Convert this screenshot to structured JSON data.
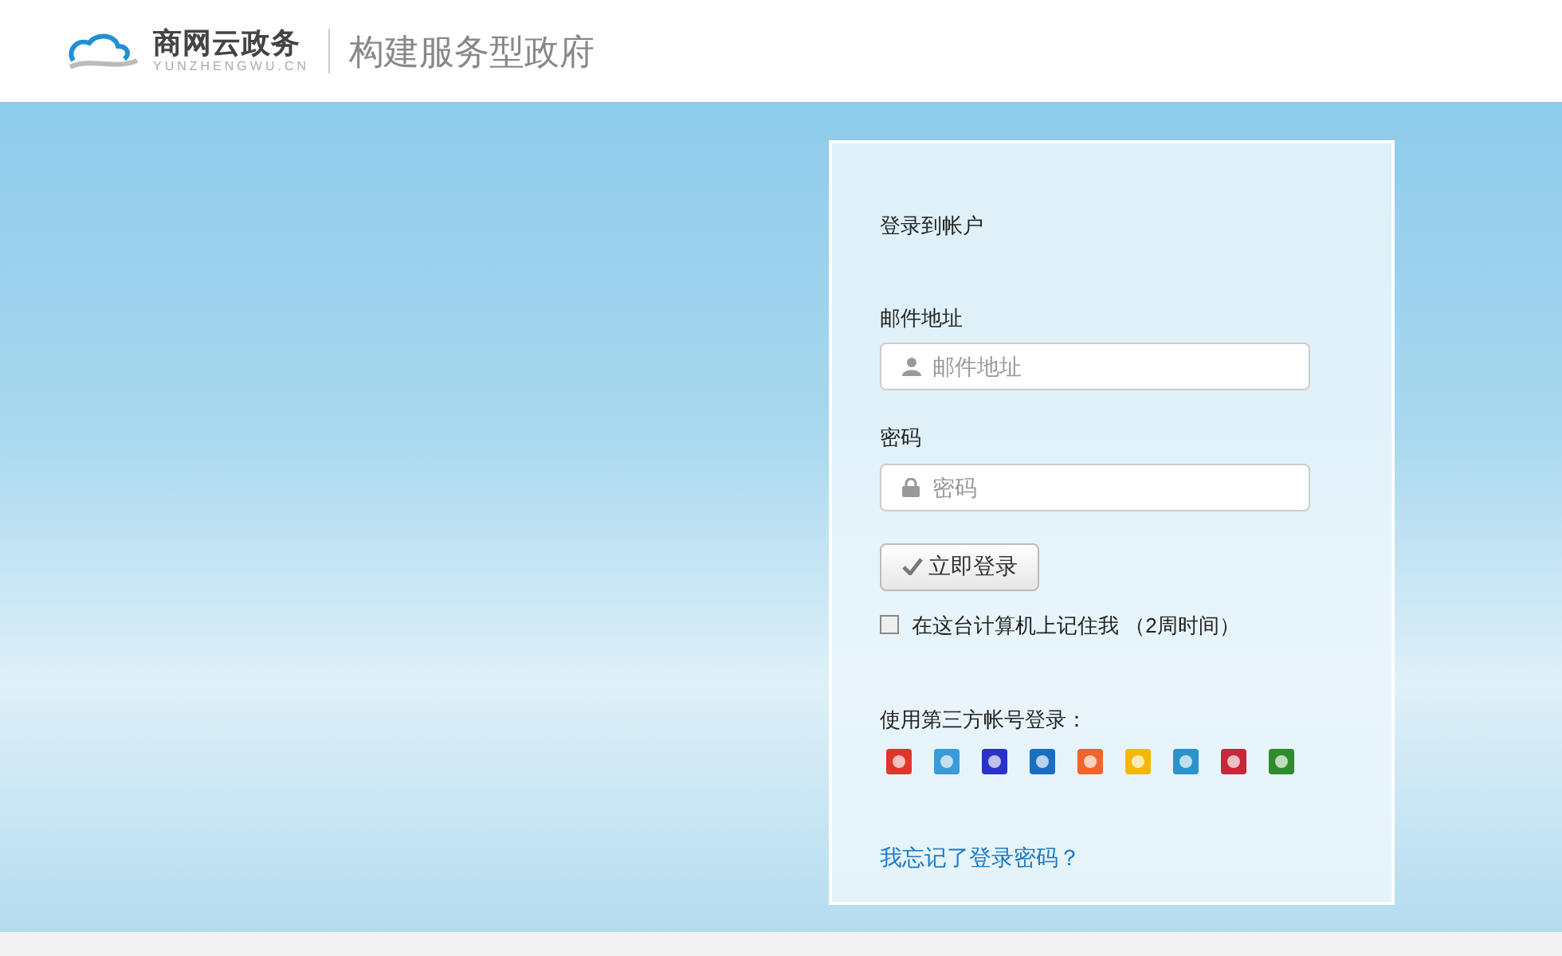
{
  "header": {
    "brand": "商网云政务",
    "domain": "YUNZHENGWU.CN",
    "slogan": "构建服务型政府"
  },
  "login": {
    "title": "登录到帐户",
    "fields": [
      {
        "kind": "email",
        "label": "邮件地址",
        "placeholder": "邮件地址"
      },
      {
        "kind": "password",
        "label": "密码",
        "placeholder": "密码"
      }
    ],
    "submit": "立即登录",
    "remember": {
      "label": "在这台计算机上记住我 （2周时间）",
      "checked": false
    },
    "third_party_label": "使用第三方帐号登录：",
    "providers": [
      {
        "color": "#e0352b"
      },
      {
        "color": "#3a9bd9"
      },
      {
        "color": "#2932c9"
      },
      {
        "color": "#1a6ec2"
      },
      {
        "color": "#f0652a"
      },
      {
        "color": "#f5b800"
      },
      {
        "color": "#2a93c9"
      },
      {
        "color": "#c6283a"
      },
      {
        "color": "#2e8b2e"
      }
    ],
    "forgot": "我忘记了登录密码？"
  }
}
